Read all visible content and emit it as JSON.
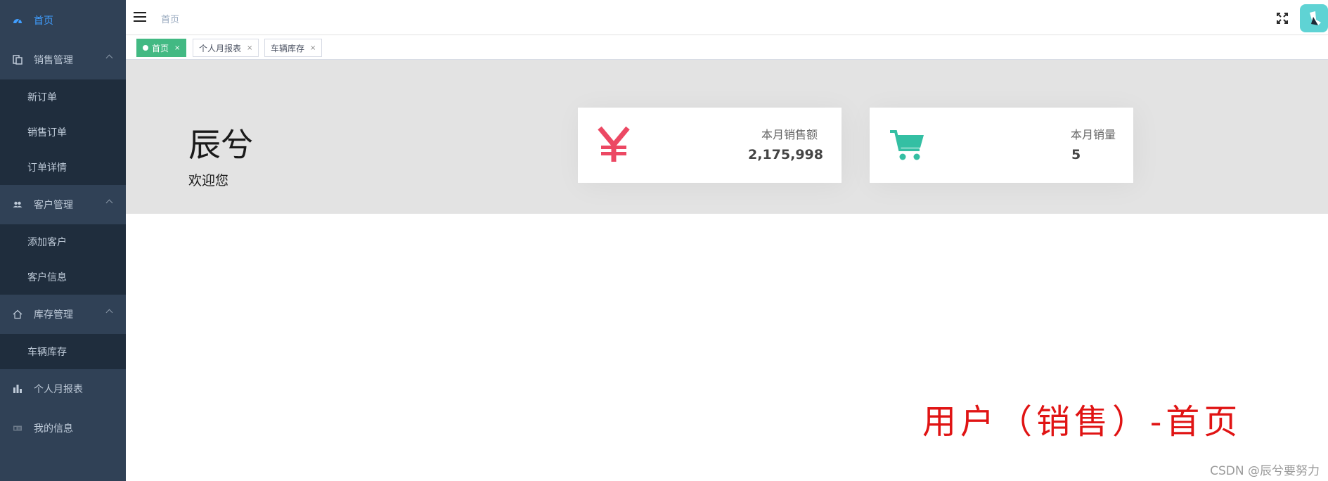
{
  "sidebar": {
    "home": "首页",
    "sales": {
      "label": "销售管理",
      "items": [
        "新订单",
        "销售订单",
        "订单详情"
      ]
    },
    "customers": {
      "label": "客户管理",
      "items": [
        "添加客户",
        "客户信息"
      ]
    },
    "inventory": {
      "label": "库存管理",
      "items": [
        "车辆库存"
      ]
    },
    "monthly_report": "个人月报表",
    "my_info": "我的信息",
    "colors": {
      "background": "#304156",
      "submenu": "#1f2d3d",
      "active": "#409eff"
    }
  },
  "navbar": {
    "breadcrumb": "首页",
    "icons": [
      "hamburger-icon",
      "fullscreen-icon",
      "avatar"
    ]
  },
  "tags": [
    {
      "label": "首页",
      "active": true,
      "close": "×"
    },
    {
      "label": "个人月报表",
      "active": false,
      "close": "×"
    },
    {
      "label": "车辆库存",
      "active": false,
      "close": "×"
    }
  ],
  "welcome": {
    "name": "辰兮",
    "subtitle": "欢迎您"
  },
  "cards": [
    {
      "icon": "yen-icon",
      "label": "本月销售额",
      "value": "2,175,998",
      "color": "#ec4863"
    },
    {
      "icon": "cart-icon",
      "label": "本月销量",
      "value": "5",
      "color": "#34bfa3"
    }
  ],
  "annotation": "用户（销售）-首页",
  "watermark": "CSDN @辰兮要努力",
  "accent": "#42b983"
}
